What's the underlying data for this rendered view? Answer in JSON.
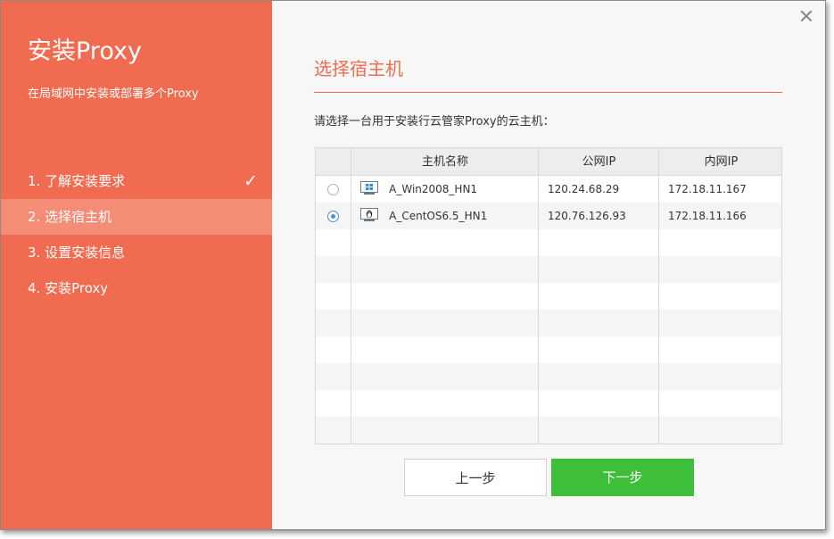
{
  "sidebar": {
    "title": "安装Proxy",
    "subtitle": "在局域网中安装或部署多个Proxy",
    "steps": [
      {
        "label": "1. 了解安装要求",
        "done": true
      },
      {
        "label": "2. 选择宿主机",
        "active": true
      },
      {
        "label": "3. 设置安装信息"
      },
      {
        "label": "4. 安装Proxy"
      }
    ],
    "check_glyph": "✓"
  },
  "main": {
    "close_glyph": "✕",
    "title": "选择宿主机",
    "instruction": "请选择一台用于安装行云管家Proxy的云主机：",
    "table": {
      "headers": [
        "",
        "主机名称",
        "公网IP",
        "内网IP"
      ],
      "rows": [
        {
          "selected": false,
          "os_icon": "windows-icon",
          "name": "A_Win2008_HN1",
          "public_ip": "120.24.68.29",
          "private_ip": "172.18.11.167"
        },
        {
          "selected": true,
          "os_icon": "linux-icon",
          "name": "A_CentOS6.5_HN1",
          "public_ip": "120.76.126.93",
          "private_ip": "172.18.11.166"
        }
      ]
    },
    "buttons": {
      "prev": "上一步",
      "next": "下一步"
    }
  },
  "colors": {
    "accent": "#f06b50",
    "sidebar_active": "#f48c76",
    "primary_button": "#3dbf3a",
    "radio_checked": "#4a90d9"
  }
}
